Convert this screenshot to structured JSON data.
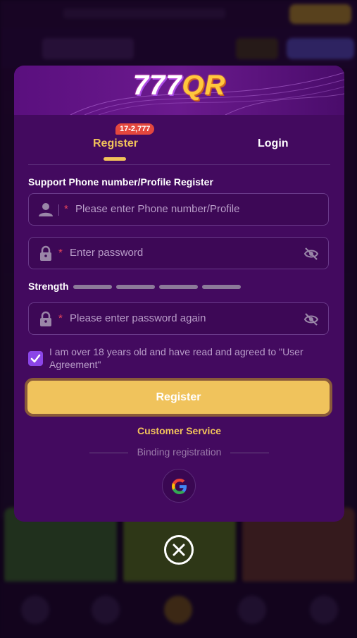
{
  "brand": {
    "part1": "777",
    "part2": "QR"
  },
  "tabs": {
    "register": {
      "label": "Register",
      "badge": "17-2,777"
    },
    "login": {
      "label": "Login"
    }
  },
  "form": {
    "section_title": "Support Phone number/Profile Register",
    "required_mark": "*",
    "phone_placeholder": "Please enter Phone number/Profile",
    "password_placeholder": "Enter password",
    "strength_label": "Strength",
    "confirm_placeholder": "Please enter password again",
    "agreement_text": "I am over 18 years old and have read and agreed to \"User Agreement\"",
    "agreement_checked": true,
    "submit_label": "Register"
  },
  "links": {
    "customer_service": "Customer Service",
    "binding_registration": "Binding registration"
  },
  "icons": {
    "user": "user-icon",
    "lock": "lock-icon",
    "eye_off": "eye-off-icon",
    "check": "check-icon",
    "google": "google-icon",
    "close": "close-icon"
  },
  "colors": {
    "modal_bg": "#430a5f",
    "accent_gold": "#f2c35a",
    "button_bg": "#f0c35c",
    "badge_red": "#e4473e",
    "required_red": "#e8455b",
    "checkbox_purple": "#8b45e8"
  }
}
